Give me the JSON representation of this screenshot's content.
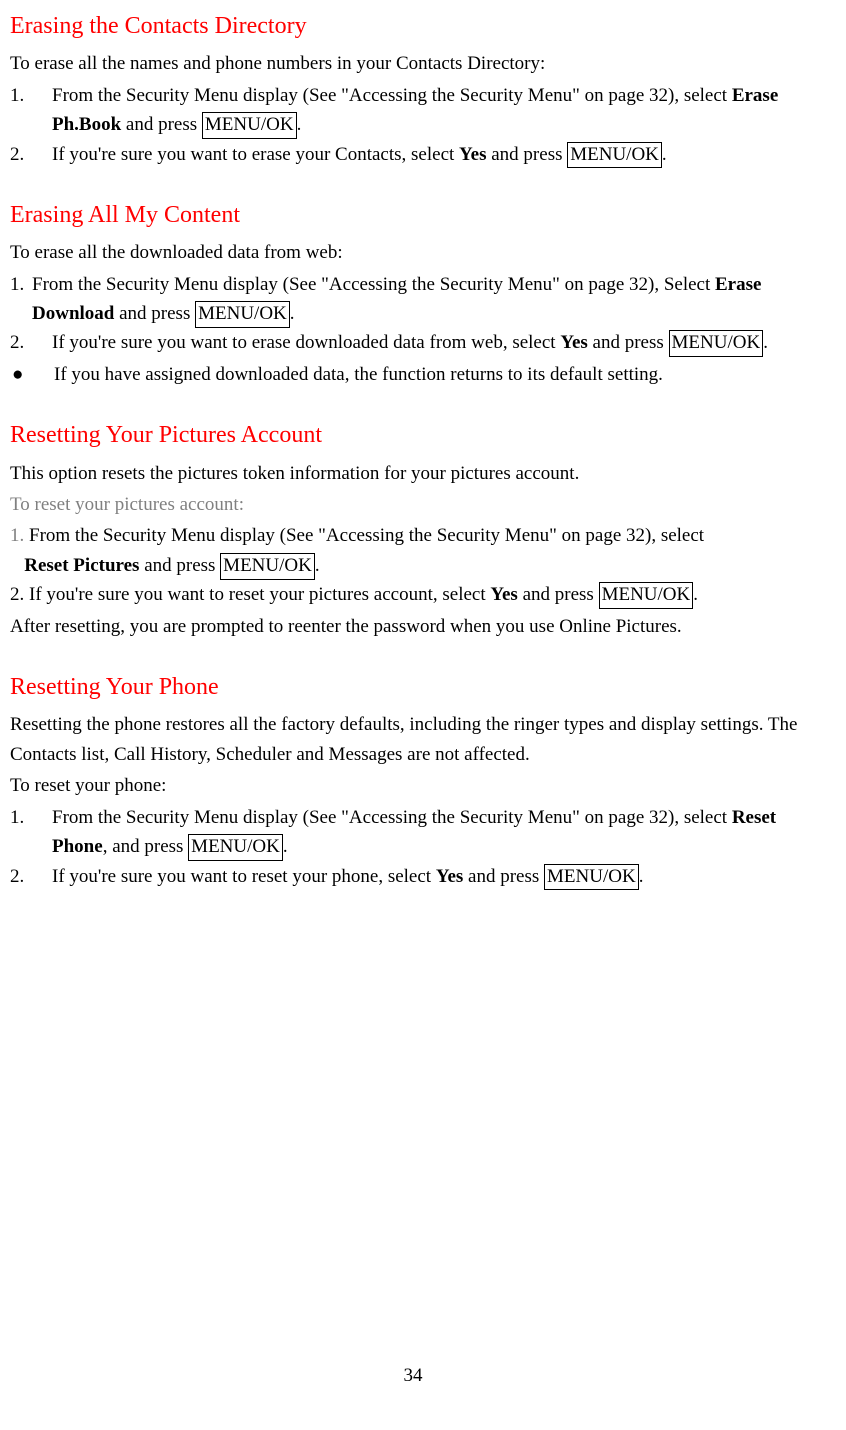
{
  "s1": {
    "heading": "Erasing the Contacts Directory",
    "intro": "To erase all the names and phone numbers in your Contacts Directory:",
    "i1": {
      "num": "1.",
      "a": "From the Security Menu display (See \"Accessing the Security Menu\" on page 32), select ",
      "bold": "Erase Ph.Book",
      "b": " and press ",
      "box": "MENU/OK",
      "c": "."
    },
    "i2": {
      "num": "2.",
      "a": "If you're sure you want to erase your Contacts, select ",
      "bold": "Yes",
      "b": " and press ",
      "box": "MENU/OK",
      "c": "."
    }
  },
  "s2": {
    "heading": "Erasing All My Content",
    "intro": "To erase all the downloaded data from web:",
    "i1": {
      "num": "1.",
      "a": "From the Security Menu display (See \"Accessing the Security Menu\" on page 32), Select ",
      "bold": "Erase Download",
      "b": " and press ",
      "box": "MENU/OK",
      "c": "."
    },
    "i2": {
      "num": "2.",
      "a": "If you're sure you want to erase downloaded data from web, select ",
      "bold": "Yes",
      "b": " and press ",
      "box": "MENU/OK",
      "c": "."
    },
    "bullet": {
      "sym": "●",
      "text": "If you have assigned downloaded data, the function returns to its default setting."
    }
  },
  "s3": {
    "heading": "Resetting Your Pictures Account",
    "intro1": "This option resets the pictures token information for your pictures account.",
    "intro2": "To reset your pictures account:",
    "i1": {
      "num": "1.",
      "a": " From the Security Menu display (See \"Accessing the Security Menu\" on page 32), select ",
      "bold": "Reset Pictures",
      "b": " and press ",
      "box": "MENU/OK",
      "c": "."
    },
    "i2": {
      "num": "2.",
      "a": " If you're sure you want to reset your pictures account, select ",
      "bold": "Yes",
      "b": " and press ",
      "box": "MENU/OK",
      "c": "."
    },
    "after": "After resetting, you are prompted to reenter the password when you use Online Pictures."
  },
  "s4": {
    "heading": "Resetting Your Phone",
    "intro1": "Resetting the phone restores all the factory defaults, including the ringer types and display settings. The Contacts list, Call History, Scheduler and Messages are not affected.",
    "intro2": "To reset your phone:",
    "i1": {
      "num": "1.",
      "a": "From the Security Menu display (See \"Accessing the Security Menu\" on page 32), select ",
      "bold": "Reset Phone",
      "b": ", and press ",
      "box": "MENU/OK",
      "c": "."
    },
    "i2": {
      "num": "2.",
      "a": "If you're sure you want to reset your phone, select ",
      "bold": "Yes",
      "b": " and press ",
      "box": "MENU/OK",
      "c": "."
    }
  },
  "pagenum": "34"
}
